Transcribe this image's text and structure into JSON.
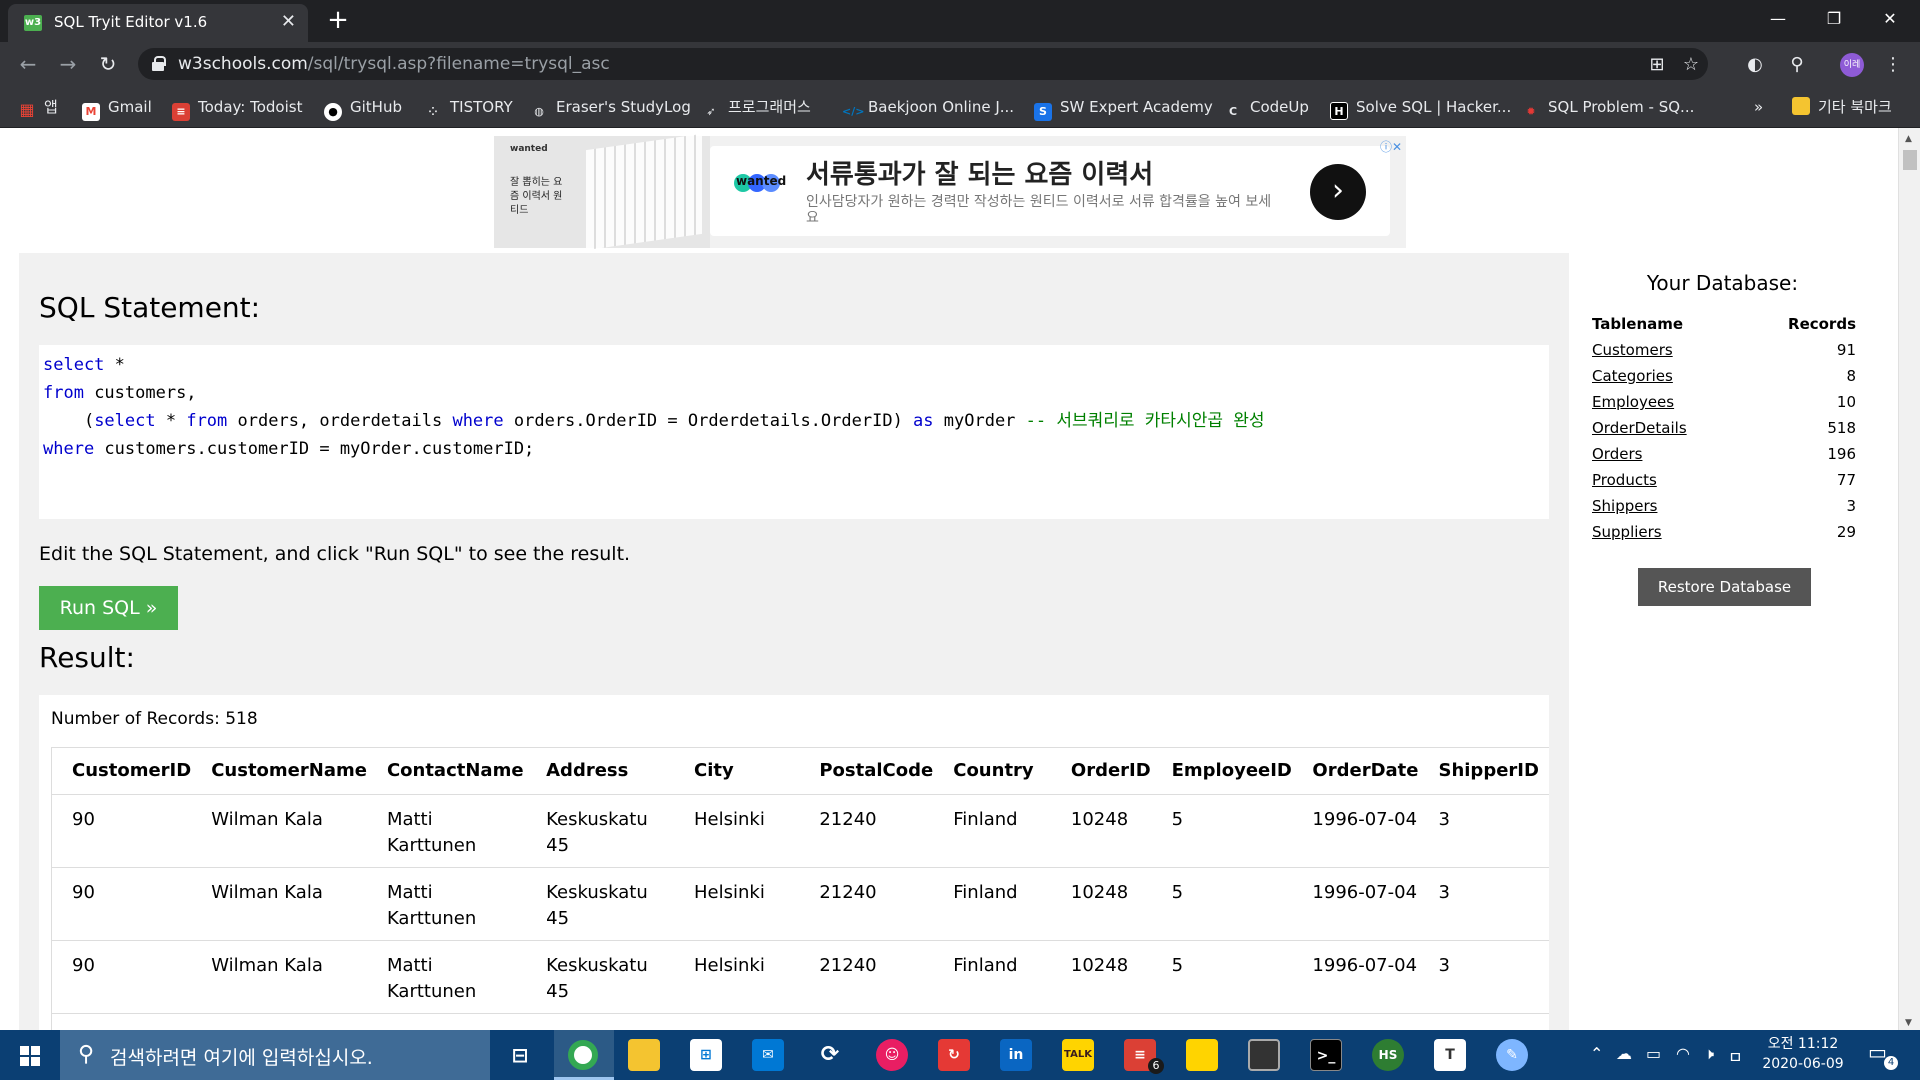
{
  "browser": {
    "tab_title": "SQL Tryit Editor v1.6",
    "tab_favicon": "w3",
    "url_host": "w3schools.com",
    "url_path": "/sql/trysql.asp?filename=trysql_asc",
    "profile": "이레"
  },
  "bookmarks": [
    {
      "label": "앱",
      "icon": "apps-icon",
      "color": "#ea4335"
    },
    {
      "label": "Gmail",
      "icon": "gmail-icon",
      "color": "#ea4335"
    },
    {
      "label": "Today: Todoist",
      "icon": "todoist-icon",
      "color": "#db4035"
    },
    {
      "label": "GitHub",
      "icon": "github-icon",
      "color": "#ffffff"
    },
    {
      "label": "TISTORY",
      "icon": "tistory-icon",
      "color": "#35363a"
    },
    {
      "label": "Eraser's StudyLog",
      "icon": "globe-icon",
      "color": "#9aa0a6"
    },
    {
      "label": "프로그래머스",
      "icon": "programmers-icon",
      "color": "#35363a"
    },
    {
      "label": "Baekjoon Online J...",
      "icon": "baekjoon-icon",
      "color": "#0076c0"
    },
    {
      "label": "SW Expert Academy",
      "icon": "swea-icon",
      "color": "#1a73e8"
    },
    {
      "label": "CodeUp",
      "icon": "codeup-icon",
      "color": "#35363a"
    },
    {
      "label": "Solve SQL | Hacker...",
      "icon": "hackerrank-icon",
      "color": "#000000"
    },
    {
      "label": "SQL Problem - SQ...",
      "icon": "bug-icon",
      "color": "#e53935"
    }
  ],
  "bookmarks_more": "»",
  "bookmarks_other": "기타 북마크",
  "ad": {
    "brand": "wanted",
    "left_text": "잘 뽑히는 요즘 이력서 원티드",
    "logo_text": "wanted",
    "title": "서류통과가 잘 되는 요즘 이력서",
    "subtitle": "인사담당자가 원하는 경력만 작성하는 원티드 이력서로 서류 합격률을 높여 보세요"
  },
  "editor": {
    "heading": "SQL Statement:",
    "code": {
      "l1_kw": "select",
      "l1_rest": " *",
      "l2_kw": "from",
      "l2_rest": " customers,",
      "l3_pre": "    (",
      "l3_kw1": "select",
      "l3_mid1": " * ",
      "l3_kw2": "from",
      "l3_mid2": " orders, orderdetails ",
      "l3_kw3": "where",
      "l3_mid3": " orders.OrderID = Orderdetails.OrderID) ",
      "l3_kw4": "as",
      "l3_mid4": " myOrder ",
      "l3_comment": "-- 서브쿼리로 카타시안곱 완성",
      "l4_kw": "where",
      "l4_rest": " customers.customerID = myOrder.customerID;"
    },
    "instruction": "Edit the SQL Statement, and click \"Run SQL\" to see the result.",
    "run_label": "Run SQL »",
    "result_heading": "Result:"
  },
  "result": {
    "count_label": "Number of Records: 518",
    "columns": [
      "CustomerID",
      "CustomerName",
      "ContactName",
      "Address",
      "City",
      "PostalCode",
      "Country",
      "OrderID",
      "EmployeeID",
      "OrderDate",
      "ShipperID"
    ],
    "rows": [
      [
        "90",
        "Wilman Kala",
        "Matti Karttunen",
        "Keskuskatu 45",
        "Helsinki",
        "21240",
        "Finland",
        "10248",
        "5",
        "1996-07-04",
        "3"
      ],
      [
        "90",
        "Wilman Kala",
        "Matti Karttunen",
        "Keskuskatu 45",
        "Helsinki",
        "21240",
        "Finland",
        "10248",
        "5",
        "1996-07-04",
        "3"
      ],
      [
        "90",
        "Wilman Kala",
        "Matti Karttunen",
        "Keskuskatu 45",
        "Helsinki",
        "21240",
        "Finland",
        "10248",
        "5",
        "1996-07-04",
        "3"
      ]
    ]
  },
  "database": {
    "title": "Your Database:",
    "col_name": "Tablename",
    "col_records": "Records",
    "tables": [
      {
        "name": "Customers",
        "records": "91"
      },
      {
        "name": "Categories",
        "records": "8"
      },
      {
        "name": "Employees",
        "records": "10"
      },
      {
        "name": "OrderDetails",
        "records": "518"
      },
      {
        "name": "Orders",
        "records": "196"
      },
      {
        "name": "Products",
        "records": "77"
      },
      {
        "name": "Shippers",
        "records": "3"
      },
      {
        "name": "Suppliers",
        "records": "29"
      }
    ],
    "restore_label": "Restore Database"
  },
  "taskbar": {
    "search_placeholder": "검색하려면 여기에 입력하십시오.",
    "todoist_badge": "6",
    "time": "오전 11:12",
    "date": "2020-06-09",
    "notification_count": "4",
    "input_lang": "ㅁ"
  },
  "colors": {
    "run_button": "#4caf50",
    "keyword": "#0000cd",
    "comment": "#008000",
    "taskbar": "#0b3f73"
  }
}
